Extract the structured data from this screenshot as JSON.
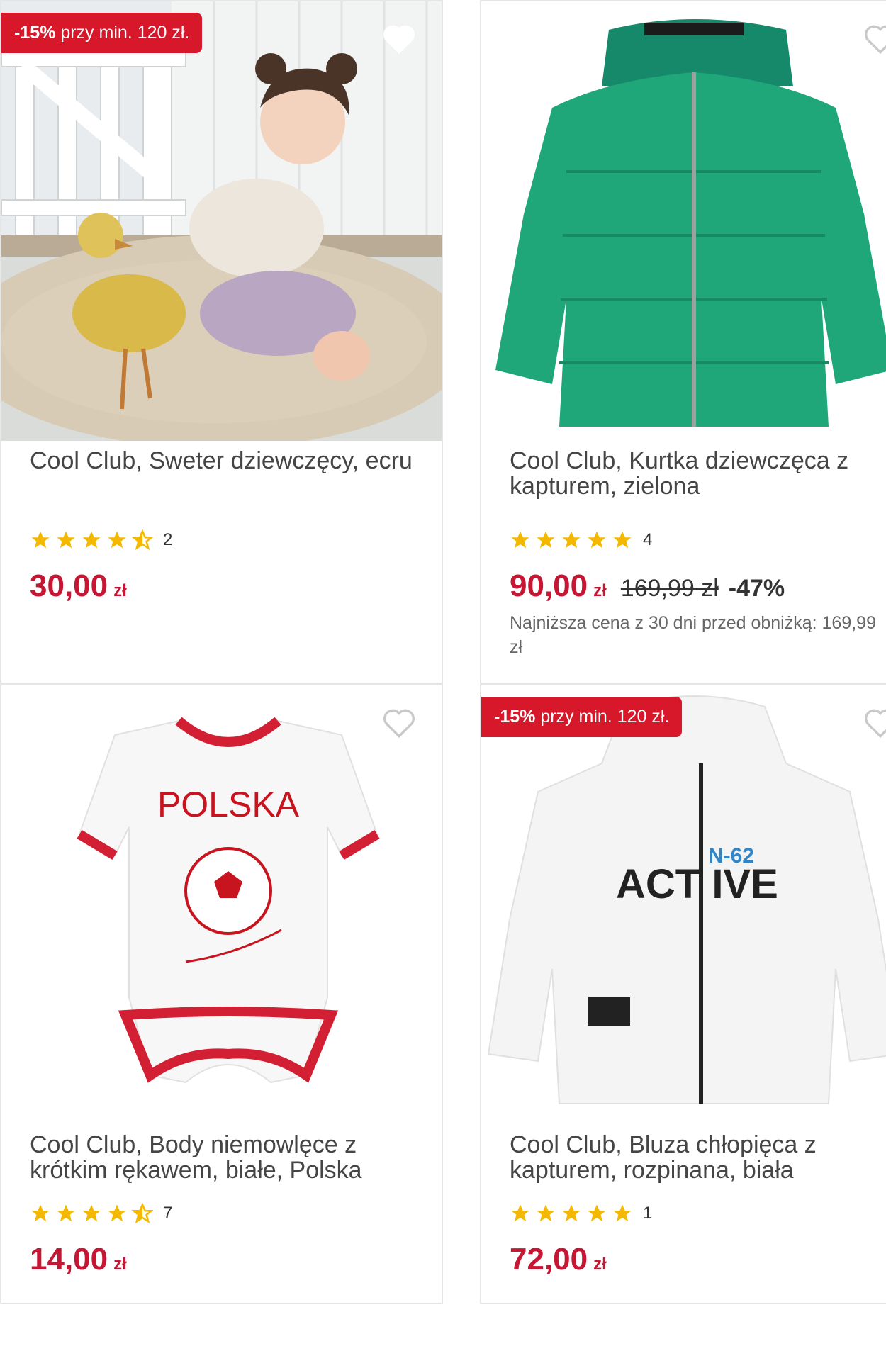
{
  "products": [
    {
      "promo_badge": {
        "pct": "-15%",
        "text": " przy min. 120 zł."
      },
      "title": "Cool Club, Sweter dziewczęcy, ecru",
      "rating_stars": 4.5,
      "review_count": "2",
      "price": "30,00",
      "currency": "zł"
    },
    {
      "title": "Cool Club, Kurtka dziewczęca z kapturem, zielona",
      "rating_stars": 5,
      "review_count": "4",
      "price": "90,00",
      "currency": "zł",
      "old_price": "169,99 zł",
      "discount": "-47%",
      "lowest_price_note": "Najniższa cena z 30 dni przed obniżką: 169,99 zł"
    },
    {
      "title": "Cool Club, Body niemowlęce z krótkim rękawem, białe, Polska",
      "rating_stars": 4.5,
      "review_count": "7",
      "price": "14,00",
      "currency": "zł",
      "print_text": "POLSKA"
    },
    {
      "promo_badge": {
        "pct": "-15%",
        "text": " przy min. 120 zł."
      },
      "title": "Cool Club, Bluza chłopięca z kapturem, rozpinana, biała",
      "rating_stars": 5,
      "review_count": "1",
      "price": "72,00",
      "currency": "zł",
      "print_text": "ACT IVE",
      "print_sub": "N-62"
    }
  ],
  "colors": {
    "accent": "#c51634",
    "promo_bg": "#d6182a",
    "star": "#f5b800",
    "jacket": "#1fa77a"
  },
  "icons": {
    "wishlist": "heart-icon",
    "rating": "star-icon"
  }
}
